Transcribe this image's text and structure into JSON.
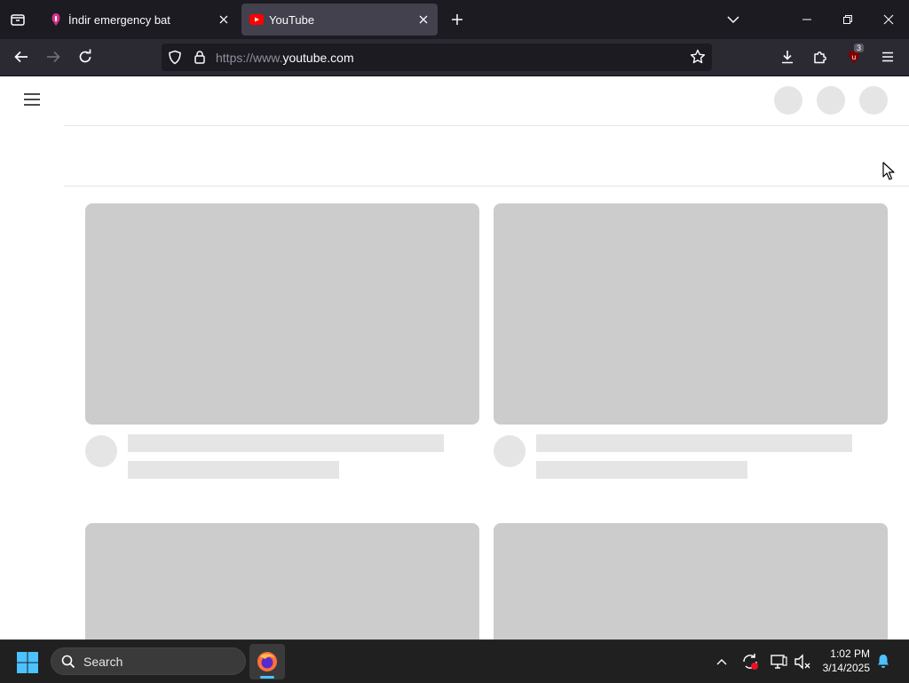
{
  "browser": {
    "tabs": [
      {
        "title": "İndir emergency bat",
        "active": false
      },
      {
        "title": "YouTube",
        "active": true
      }
    ],
    "url": {
      "scheme_prefix": "https://www.",
      "host": "youtube.com"
    },
    "extension_badge": "3",
    "icons": {
      "list_all_tabs": "tab-list-icon",
      "new_tab": "plus-icon",
      "tab_overflow": "chevron-down-icon",
      "back": "back-arrow-icon",
      "forward": "forward-arrow-icon",
      "reload": "reload-icon",
      "tracking_protection": "shield-icon",
      "site_security": "lock-icon",
      "bookmark": "star-icon",
      "downloads": "download-icon",
      "extensions": "puzzle-icon",
      "ublock": "ublock-icon",
      "menu": "hamburger-icon"
    }
  },
  "page": {
    "state": "loading-skeleton",
    "menu_icon": "hamburger-icon"
  },
  "taskbar": {
    "search_placeholder": "Search",
    "clock_time": "1:02 PM",
    "clock_date": "3/14/2025",
    "pinned_apps": [
      "firefox-icon"
    ],
    "tray_icons": [
      "chevron-up-icon",
      "sync-icon",
      "network-icon",
      "volume-muted-icon",
      "notification-bell-icon"
    ]
  },
  "colors": {
    "tabbar_bg": "#1c1b22",
    "navbar_bg": "#2b2a33",
    "active_tab": "#42414d",
    "skeleton": "#cccccc",
    "taskbar_bg": "#202020",
    "accent": "#0078d4"
  }
}
